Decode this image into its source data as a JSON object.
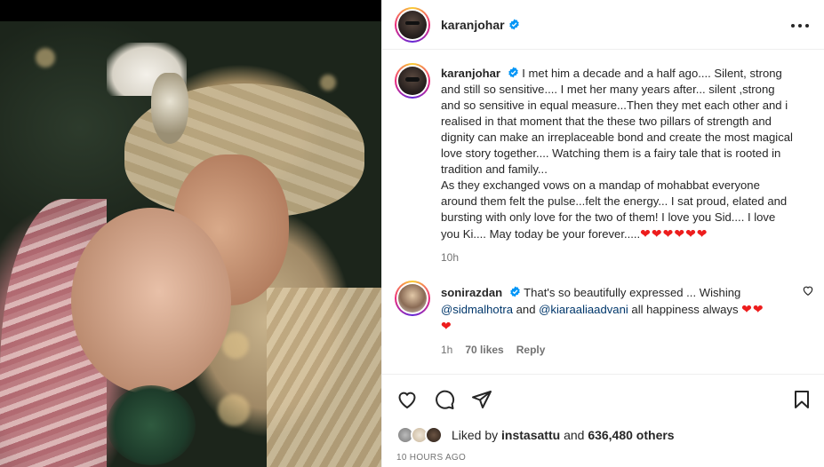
{
  "post": {
    "username": "karanjohar"
  },
  "caption": {
    "username": "karanjohar",
    "text": "I met him a decade and a half ago.... Silent, strong and still so sensitive.... I met her many years after... silent ,strong and so sensitive in equal measure...Then they met each other and i realised in that moment that the these two pillars of strength and dignity can make an irreplaceable bond and create the most magical love story together.... Watching them is a fairy tale that is rooted in tradition and family...",
    "text2": "As they exchanged vows on a mandap of mohabbat everyone around them felt the pulse...felt the energy... I sat proud, elated and bursting with only love for the two of them! I love you Sid.... I love you Ki.... May today be your forever.....",
    "hearts": "❤❤❤❤❤❤",
    "time": "10h"
  },
  "reply": {
    "username": "sonirazdan",
    "text_before": "That's so beautifully expressed ... Wishing",
    "mention1": "@sidmalhotra",
    "and": "and",
    "mention2": "@kiaraaliaadvani",
    "text_after": "all happiness always",
    "hearts": "❤❤",
    "hearts2": "❤",
    "time": "1h",
    "likes": "70 likes",
    "reply_label": "Reply"
  },
  "likes": {
    "prefix": "Liked by",
    "user": "instasattu",
    "and": "and",
    "others": "636,480 others"
  },
  "timestamp": "10 HOURS AGO",
  "colors": {
    "verified": "#0095f6",
    "heart": "#ed1d1d",
    "mention": "#00376b",
    "meta": "#737373"
  }
}
